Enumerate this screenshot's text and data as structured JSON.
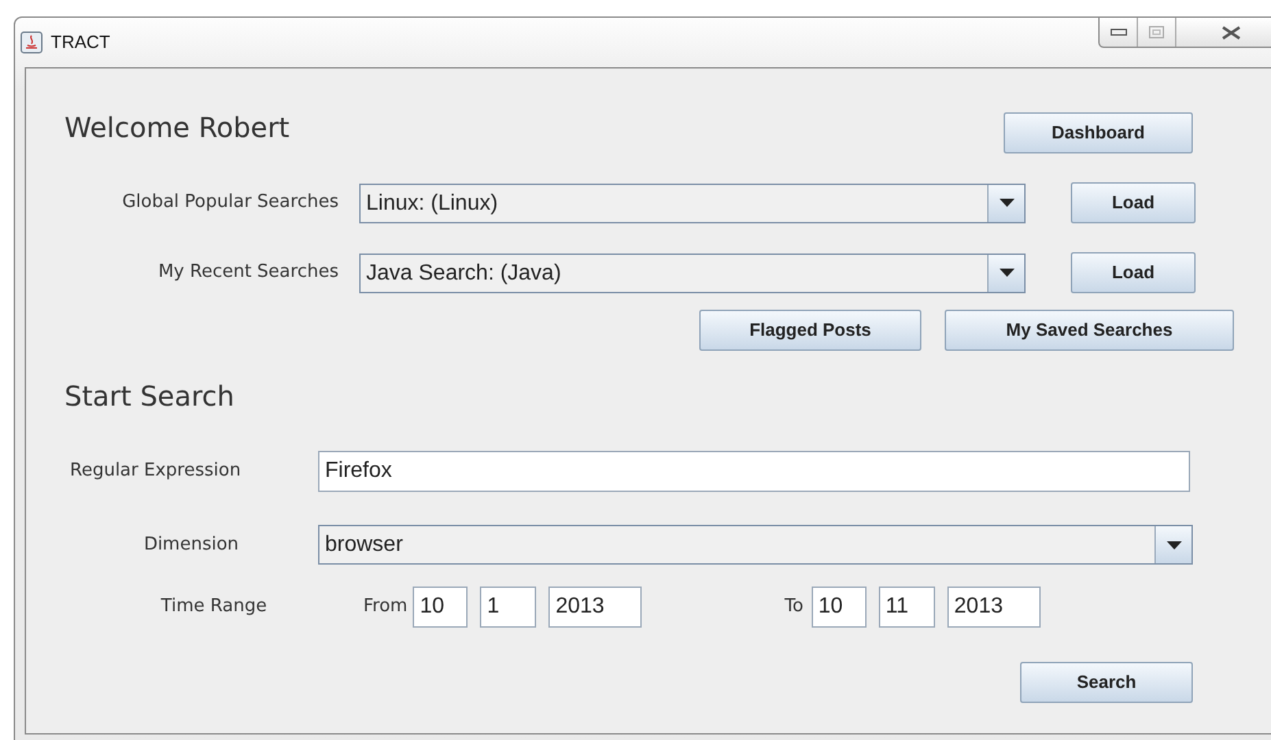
{
  "window": {
    "title": "TRACT"
  },
  "welcome": "Welcome Robert",
  "dashboard_button": "Dashboard",
  "saved_rows": [
    {
      "label": "Global Popular Searches",
      "value": "Linux: (Linux)",
      "button": "Load"
    },
    {
      "label": "My Recent Searches",
      "value": "Java Search: (Java)",
      "button": "Load"
    }
  ],
  "flagged_button": "Flagged Posts",
  "saved_searches_button": "My Saved Searches",
  "start_heading": "Start Search",
  "regex": {
    "label": "Regular Expression",
    "value": "Firefox"
  },
  "dimension": {
    "label": "Dimension",
    "value": "browser"
  },
  "time_range": {
    "label": "Time Range",
    "from_label": "From",
    "from": [
      "10",
      "1",
      "2013"
    ],
    "to_label": "To",
    "to": [
      "10",
      "11",
      "2013"
    ]
  },
  "search_button": "Search"
}
